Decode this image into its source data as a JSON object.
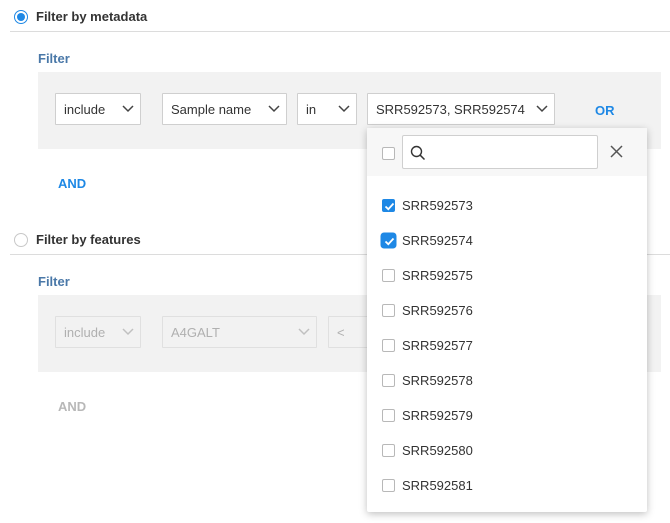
{
  "metadata_section": {
    "radio_label": "Filter by metadata",
    "selected": true,
    "filter_label": "Filter",
    "mode_select": "include",
    "field_select": "Sample name",
    "operator_select": "in",
    "values_select": "SRR592573, SRR592574",
    "or_button": "OR",
    "and_button": "AND"
  },
  "features_section": {
    "radio_label": "Filter by features",
    "selected": false,
    "filter_label": "Filter",
    "mode_select": "include",
    "feature_select": "A4GALT",
    "operator_select": "<",
    "and_button": "AND"
  },
  "dropdown": {
    "search_placeholder": "",
    "search_value": "",
    "options": [
      {
        "label": "SRR592573",
        "checked": true
      },
      {
        "label": "SRR592574",
        "checked": true
      },
      {
        "label": "SRR592575",
        "checked": false
      },
      {
        "label": "SRR592576",
        "checked": false
      },
      {
        "label": "SRR592577",
        "checked": false
      },
      {
        "label": "SRR592578",
        "checked": false
      },
      {
        "label": "SRR592579",
        "checked": false
      },
      {
        "label": "SRR592580",
        "checked": false
      },
      {
        "label": "SRR592581",
        "checked": false
      }
    ]
  },
  "colors": {
    "accent": "#1e88e5",
    "filter_label": "#4a78a8",
    "panel_bg": "#f2f2f2"
  }
}
